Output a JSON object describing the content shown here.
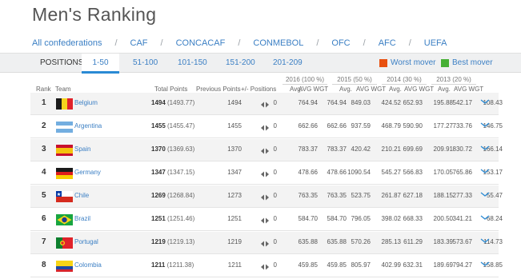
{
  "title": "Men's Ranking",
  "confederations": [
    "All confederations",
    "CAF",
    "CONCACAF",
    "CONMEBOL",
    "OFC",
    "AFC",
    "UEFA"
  ],
  "positions": {
    "label": "POSITIONS",
    "tabs": [
      "1-50",
      "51-100",
      "101-150",
      "151-200",
      "201-209"
    ],
    "active_tab": "1-50"
  },
  "legend": {
    "worst_label": "Worst mover",
    "worst_color": "#e8500f",
    "best_label": "Best mover",
    "best_color": "#47b035"
  },
  "table": {
    "year_headers": [
      "2016 (100 %)",
      "2015 (50 %)",
      "2014 (30 %)",
      "2013 (20 %)"
    ],
    "headers": {
      "rank": "Rank",
      "team": "Team",
      "total": "Total Points",
      "previous": "Previous Points",
      "change": "+/- Positions",
      "avg": "Avg.",
      "avg_wgt": "AVG WGT"
    },
    "rows": [
      {
        "rank": "1",
        "team": "Belgium",
        "total": "1494",
        "total_exact": "(1493.77)",
        "previous": "1494",
        "change": "0",
        "y2016_avg": "764.94",
        "y2016_wgt": "764.94",
        "y2015_avg": "849.03",
        "y2015_wgt": "424.52",
        "y2014_avg": "652.93",
        "y2014_wgt": "195.88",
        "y2013_avg": "542.17",
        "y2013_wgt": "108.43",
        "flag": "belgium"
      },
      {
        "rank": "2",
        "team": "Argentina",
        "total": "1455",
        "total_exact": "(1455.47)",
        "previous": "1455",
        "change": "0",
        "y2016_avg": "662.66",
        "y2016_wgt": "662.66",
        "y2015_avg": "937.59",
        "y2015_wgt": "468.79",
        "y2014_avg": "590.90",
        "y2014_wgt": "177.27",
        "y2013_avg": "733.76",
        "y2013_wgt": "146.75",
        "flag": "argentina"
      },
      {
        "rank": "3",
        "team": "Spain",
        "total": "1370",
        "total_exact": "(1369.63)",
        "previous": "1370",
        "change": "0",
        "y2016_avg": "783.37",
        "y2016_wgt": "783.37",
        "y2015_avg": "420.42",
        "y2015_wgt": "210.21",
        "y2014_avg": "699.69",
        "y2014_wgt": "209.91",
        "y2013_avg": "830.72",
        "y2013_wgt": "166.14",
        "flag": "spain"
      },
      {
        "rank": "4",
        "team": "Germany",
        "total": "1347",
        "total_exact": "(1347.15)",
        "previous": "1347",
        "change": "0",
        "y2016_avg": "478.66",
        "y2016_wgt": "478.66",
        "y2015_avg": "1090.54",
        "y2015_wgt": "545.27",
        "y2014_avg": "566.83",
        "y2014_wgt": "170.05",
        "y2013_avg": "765.86",
        "y2013_wgt": "153.17",
        "flag": "germany"
      },
      {
        "rank": "5",
        "team": "Chile",
        "total": "1269",
        "total_exact": "(1268.84)",
        "previous": "1273",
        "change": "0",
        "y2016_avg": "763.35",
        "y2016_wgt": "763.35",
        "y2015_avg": "523.75",
        "y2015_wgt": "261.87",
        "y2014_avg": "627.18",
        "y2014_wgt": "188.15",
        "y2013_avg": "277.33",
        "y2013_wgt": "55.47",
        "flag": "chile"
      },
      {
        "rank": "6",
        "team": "Brazil",
        "total": "1251",
        "total_exact": "(1251.46)",
        "previous": "1251",
        "change": "0",
        "y2016_avg": "584.70",
        "y2016_wgt": "584.70",
        "y2015_avg": "796.05",
        "y2015_wgt": "398.02",
        "y2014_avg": "668.33",
        "y2014_wgt": "200.50",
        "y2013_avg": "341.21",
        "y2013_wgt": "68.24",
        "flag": "brazil"
      },
      {
        "rank": "7",
        "team": "Portugal",
        "total": "1219",
        "total_exact": "(1219.13)",
        "previous": "1219",
        "change": "0",
        "y2016_avg": "635.88",
        "y2016_wgt": "635.88",
        "y2015_avg": "570.26",
        "y2015_wgt": "285.13",
        "y2014_avg": "611.29",
        "y2014_wgt": "183.39",
        "y2013_avg": "573.67",
        "y2013_wgt": "114.73",
        "flag": "portugal"
      },
      {
        "rank": "8",
        "team": "Colombia",
        "total": "1211",
        "total_exact": "(1211.38)",
        "previous": "1211",
        "change": "0",
        "y2016_avg": "459.85",
        "y2016_wgt": "459.85",
        "y2015_avg": "805.97",
        "y2015_wgt": "402.99",
        "y2014_avg": "632.31",
        "y2014_wgt": "189.69",
        "y2013_avg": "794.27",
        "y2013_wgt": "158.85",
        "flag": "colombia"
      }
    ]
  }
}
